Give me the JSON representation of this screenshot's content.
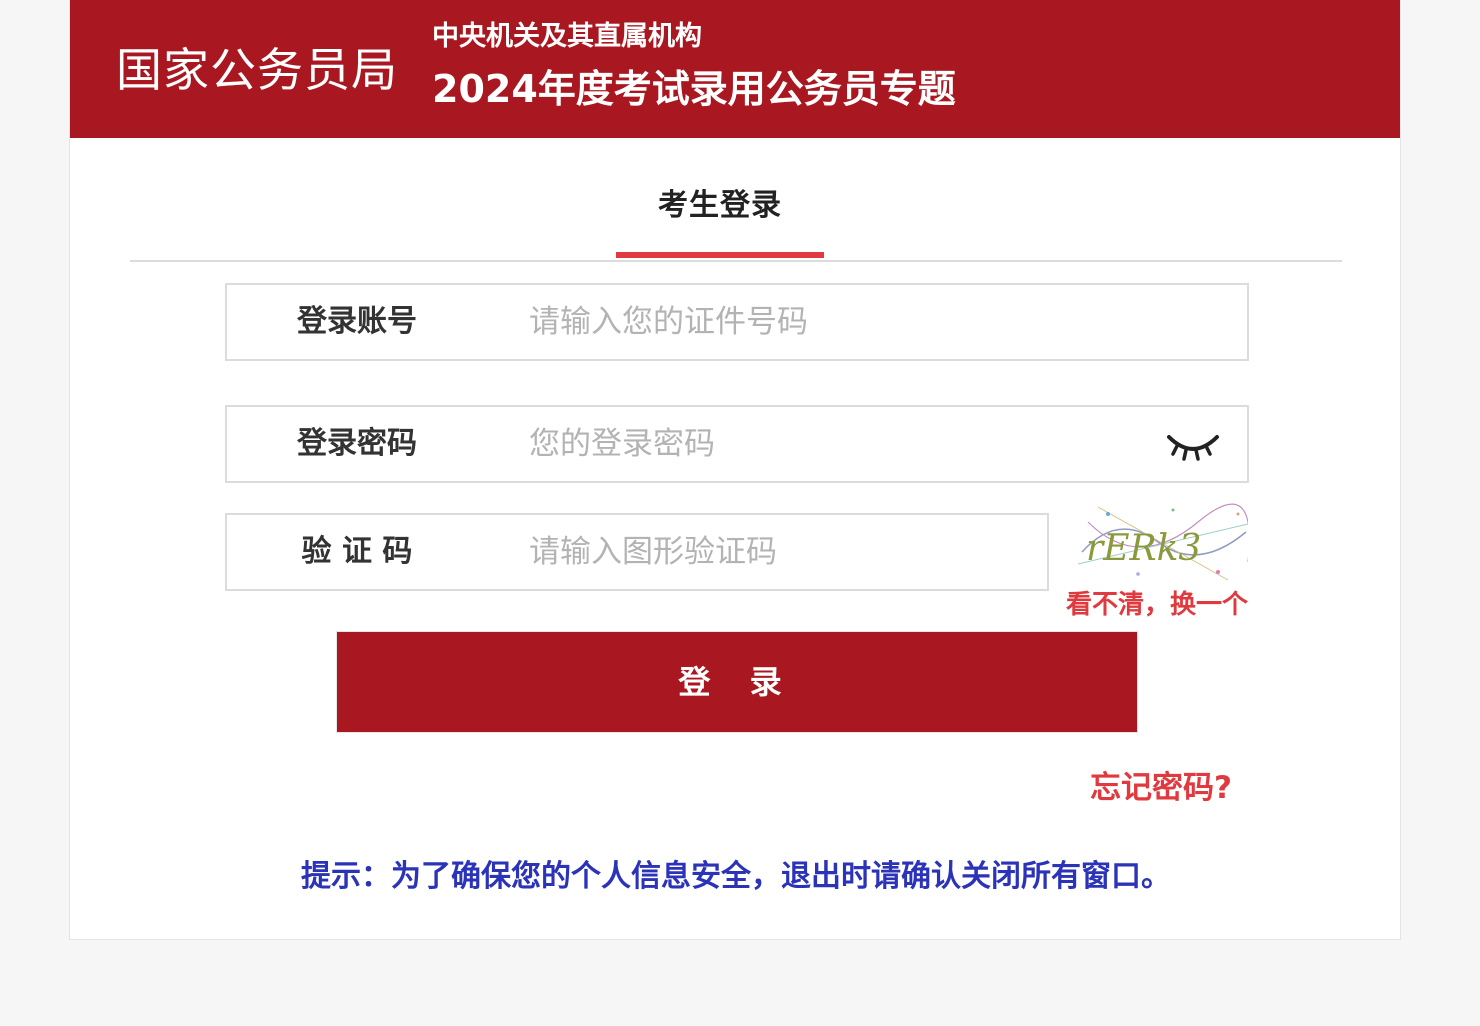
{
  "header": {
    "org_name": "国家公务员局",
    "org_sub": "中央机关及其直属机构",
    "topic_title": "2024年度考试录用公务员专题"
  },
  "tabs": [
    {
      "label": "考生登录",
      "active": true
    }
  ],
  "form": {
    "account": {
      "label": "登录账号",
      "placeholder": "请输入您的证件号码",
      "value": ""
    },
    "password": {
      "label": "登录密码",
      "placeholder": "您的登录密码",
      "value": "",
      "toggle_icon": "eye-closed-icon"
    },
    "captcha": {
      "label": "验 证 码",
      "placeholder": "请输入图形验证码",
      "value": "",
      "image_text": "rERk3",
      "refresh_label": "看不清，换一个"
    },
    "login_button": "登 录",
    "forgot_password": "忘记密码?"
  },
  "hint": "提示：为了确保您的个人信息安全，退出时请确认关闭所有窗口。",
  "colors": {
    "brand_red": "#a91820",
    "accent_red": "#e03a3e",
    "hint_blue": "#2b33b8",
    "page_bg": "#f6f6f6"
  }
}
